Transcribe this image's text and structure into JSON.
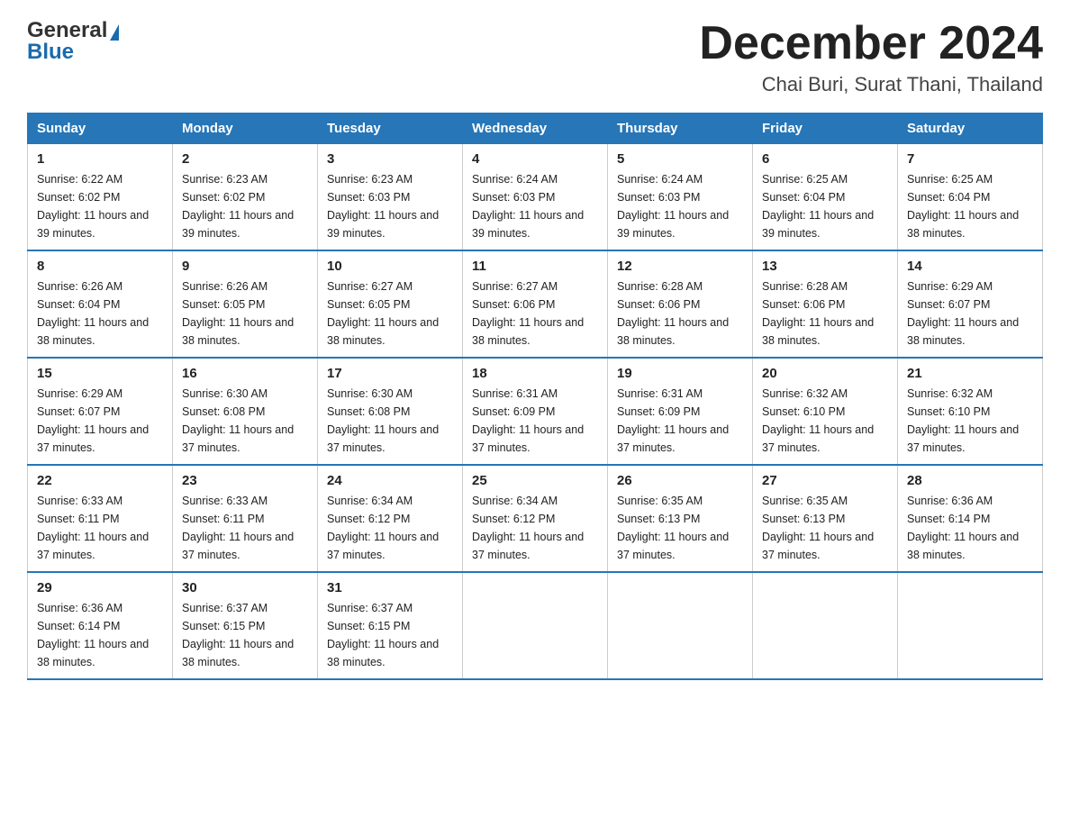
{
  "header": {
    "logo": {
      "general": "General",
      "blue": "Blue",
      "triangle": "▲"
    },
    "title": "December 2024",
    "subtitle": "Chai Buri, Surat Thani, Thailand"
  },
  "days_of_week": [
    "Sunday",
    "Monday",
    "Tuesday",
    "Wednesday",
    "Thursday",
    "Friday",
    "Saturday"
  ],
  "weeks": [
    [
      {
        "day": "1",
        "sunrise": "6:22 AM",
        "sunset": "6:02 PM",
        "daylight": "11 hours and 39 minutes."
      },
      {
        "day": "2",
        "sunrise": "6:23 AM",
        "sunset": "6:02 PM",
        "daylight": "11 hours and 39 minutes."
      },
      {
        "day": "3",
        "sunrise": "6:23 AM",
        "sunset": "6:03 PM",
        "daylight": "11 hours and 39 minutes."
      },
      {
        "day": "4",
        "sunrise": "6:24 AM",
        "sunset": "6:03 PM",
        "daylight": "11 hours and 39 minutes."
      },
      {
        "day": "5",
        "sunrise": "6:24 AM",
        "sunset": "6:03 PM",
        "daylight": "11 hours and 39 minutes."
      },
      {
        "day": "6",
        "sunrise": "6:25 AM",
        "sunset": "6:04 PM",
        "daylight": "11 hours and 39 minutes."
      },
      {
        "day": "7",
        "sunrise": "6:25 AM",
        "sunset": "6:04 PM",
        "daylight": "11 hours and 38 minutes."
      }
    ],
    [
      {
        "day": "8",
        "sunrise": "6:26 AM",
        "sunset": "6:04 PM",
        "daylight": "11 hours and 38 minutes."
      },
      {
        "day": "9",
        "sunrise": "6:26 AM",
        "sunset": "6:05 PM",
        "daylight": "11 hours and 38 minutes."
      },
      {
        "day": "10",
        "sunrise": "6:27 AM",
        "sunset": "6:05 PM",
        "daylight": "11 hours and 38 minutes."
      },
      {
        "day": "11",
        "sunrise": "6:27 AM",
        "sunset": "6:06 PM",
        "daylight": "11 hours and 38 minutes."
      },
      {
        "day": "12",
        "sunrise": "6:28 AM",
        "sunset": "6:06 PM",
        "daylight": "11 hours and 38 minutes."
      },
      {
        "day": "13",
        "sunrise": "6:28 AM",
        "sunset": "6:06 PM",
        "daylight": "11 hours and 38 minutes."
      },
      {
        "day": "14",
        "sunrise": "6:29 AM",
        "sunset": "6:07 PM",
        "daylight": "11 hours and 38 minutes."
      }
    ],
    [
      {
        "day": "15",
        "sunrise": "6:29 AM",
        "sunset": "6:07 PM",
        "daylight": "11 hours and 37 minutes."
      },
      {
        "day": "16",
        "sunrise": "6:30 AM",
        "sunset": "6:08 PM",
        "daylight": "11 hours and 37 minutes."
      },
      {
        "day": "17",
        "sunrise": "6:30 AM",
        "sunset": "6:08 PM",
        "daylight": "11 hours and 37 minutes."
      },
      {
        "day": "18",
        "sunrise": "6:31 AM",
        "sunset": "6:09 PM",
        "daylight": "11 hours and 37 minutes."
      },
      {
        "day": "19",
        "sunrise": "6:31 AM",
        "sunset": "6:09 PM",
        "daylight": "11 hours and 37 minutes."
      },
      {
        "day": "20",
        "sunrise": "6:32 AM",
        "sunset": "6:10 PM",
        "daylight": "11 hours and 37 minutes."
      },
      {
        "day": "21",
        "sunrise": "6:32 AM",
        "sunset": "6:10 PM",
        "daylight": "11 hours and 37 minutes."
      }
    ],
    [
      {
        "day": "22",
        "sunrise": "6:33 AM",
        "sunset": "6:11 PM",
        "daylight": "11 hours and 37 minutes."
      },
      {
        "day": "23",
        "sunrise": "6:33 AM",
        "sunset": "6:11 PM",
        "daylight": "11 hours and 37 minutes."
      },
      {
        "day": "24",
        "sunrise": "6:34 AM",
        "sunset": "6:12 PM",
        "daylight": "11 hours and 37 minutes."
      },
      {
        "day": "25",
        "sunrise": "6:34 AM",
        "sunset": "6:12 PM",
        "daylight": "11 hours and 37 minutes."
      },
      {
        "day": "26",
        "sunrise": "6:35 AM",
        "sunset": "6:13 PM",
        "daylight": "11 hours and 37 minutes."
      },
      {
        "day": "27",
        "sunrise": "6:35 AM",
        "sunset": "6:13 PM",
        "daylight": "11 hours and 37 minutes."
      },
      {
        "day": "28",
        "sunrise": "6:36 AM",
        "sunset": "6:14 PM",
        "daylight": "11 hours and 38 minutes."
      }
    ],
    [
      {
        "day": "29",
        "sunrise": "6:36 AM",
        "sunset": "6:14 PM",
        "daylight": "11 hours and 38 minutes."
      },
      {
        "day": "30",
        "sunrise": "6:37 AM",
        "sunset": "6:15 PM",
        "daylight": "11 hours and 38 minutes."
      },
      {
        "day": "31",
        "sunrise": "6:37 AM",
        "sunset": "6:15 PM",
        "daylight": "11 hours and 38 minutes."
      },
      null,
      null,
      null,
      null
    ]
  ]
}
